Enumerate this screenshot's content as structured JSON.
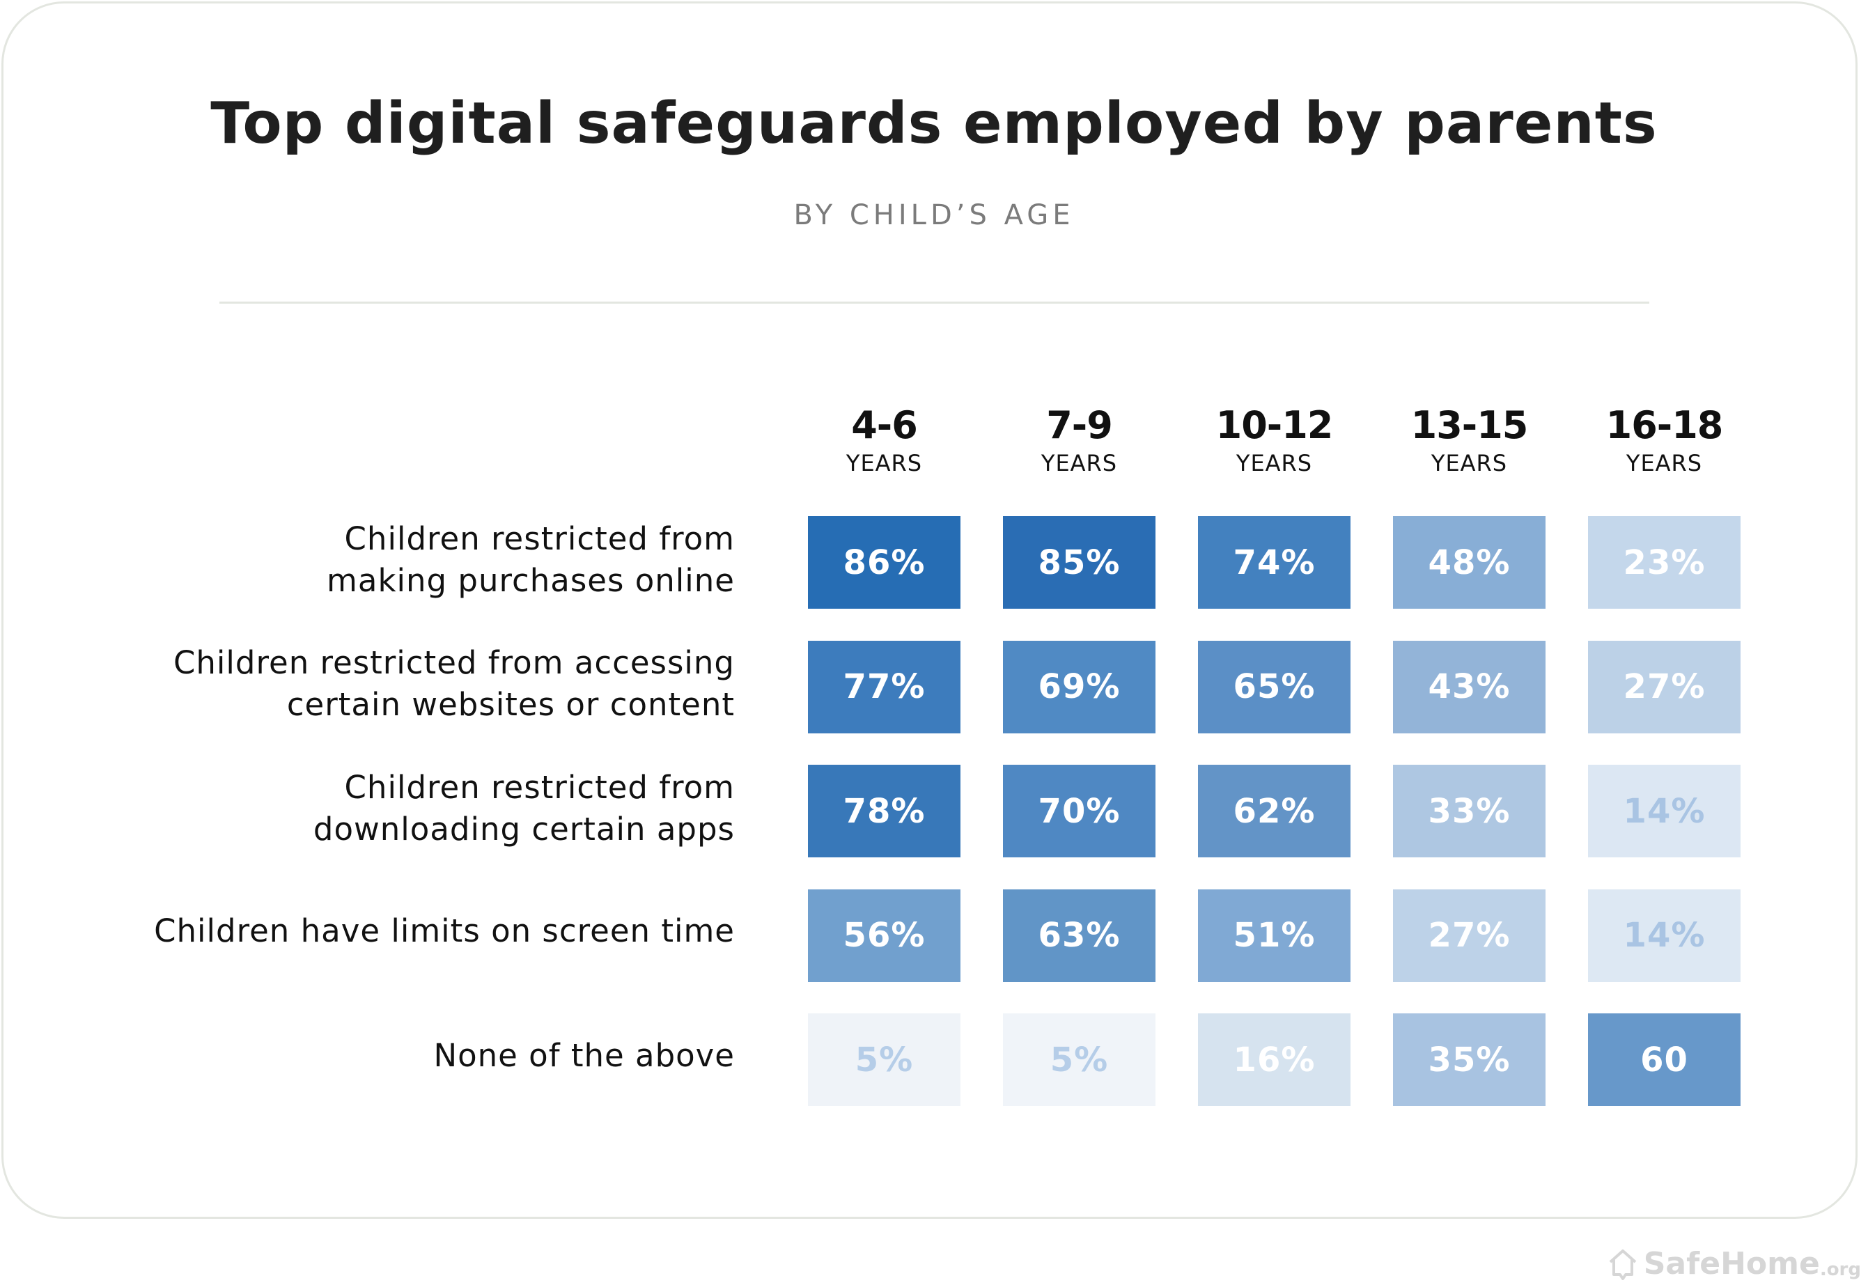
{
  "chart_data": {
    "type": "heatmap",
    "title": "Top digital safeguards employed by parents",
    "subtitle": "BY CHILD’S AGE",
    "columns": [
      {
        "range": "4-6",
        "unit": "YEARS"
      },
      {
        "range": "7-9",
        "unit": "YEARS"
      },
      {
        "range": "10-12",
        "unit": "YEARS"
      },
      {
        "range": "13-15",
        "unit": "YEARS"
      },
      {
        "range": "16-18",
        "unit": "YEARS"
      }
    ],
    "rows": [
      {
        "label": [
          "Children restricted from",
          "making purchases online"
        ],
        "values": [
          86,
          85,
          74,
          48,
          23
        ],
        "display": [
          "86%",
          "85%",
          "74%",
          "48%",
          "23%"
        ],
        "colors": [
          "#266db4",
          "#2a6db4",
          "#4381bf",
          "#88aed6",
          "#c4d7eb"
        ],
        "text_colors": [
          "#ffffff",
          "#ffffff",
          "#ffffff",
          "#ffffff",
          "#ffffff"
        ]
      },
      {
        "label": [
          "Children restricted from accessing",
          "certain websites or content"
        ],
        "values": [
          77,
          69,
          65,
          43,
          27
        ],
        "display": [
          "77%",
          "69%",
          "65%",
          "43%",
          "27%"
        ],
        "colors": [
          "#3d7cbd",
          "#508ac4",
          "#5b8fc6",
          "#93b4d8",
          "#bcd1e7"
        ],
        "text_colors": [
          "#ffffff",
          "#ffffff",
          "#ffffff",
          "#ffffff",
          "#ffffff"
        ]
      },
      {
        "label": [
          "Children restricted from",
          "downloading certain apps"
        ],
        "values": [
          78,
          70,
          62,
          33,
          14
        ],
        "display": [
          "78%",
          "70%",
          "62%",
          "33%",
          "14%"
        ],
        "colors": [
          "#3878b9",
          "#4f88c3",
          "#6394c7",
          "#aec7e2",
          "#dce7f3"
        ],
        "text_colors": [
          "#ffffff",
          "#ffffff",
          "#ffffff",
          "#ffffff",
          "#a9c4e3"
        ]
      },
      {
        "label": [
          "Children have limits on screen time"
        ],
        "values": [
          56,
          63,
          51,
          27,
          14
        ],
        "display": [
          "56%",
          "63%",
          "51%",
          "27%",
          "14%"
        ],
        "colors": [
          "#71a0ce",
          "#6195c7",
          "#80a9d4",
          "#bdd2e8",
          "#dde8f3"
        ],
        "text_colors": [
          "#ffffff",
          "#ffffff",
          "#ffffff",
          "#ffffff",
          "#a9c4e3"
        ]
      },
      {
        "label": [
          "None of the above"
        ],
        "values": [
          5,
          5,
          16,
          35,
          60
        ],
        "display": [
          "5%",
          "5%",
          "16%",
          "35%",
          "60"
        ],
        "colors": [
          "#eff3f8",
          "#f0f4f9",
          "#d6e3ef",
          "#a8c3e1",
          "#6798ca"
        ],
        "text_colors": [
          "#b5cde8",
          "#b5cde8",
          "#ffffff",
          "#ffffff",
          "#ffffff"
        ]
      }
    ],
    "value_unit": "%"
  },
  "branding": {
    "logo_name": "SafeHome",
    "logo_tld": ".org",
    "logo_color": "#d6d6d6"
  }
}
